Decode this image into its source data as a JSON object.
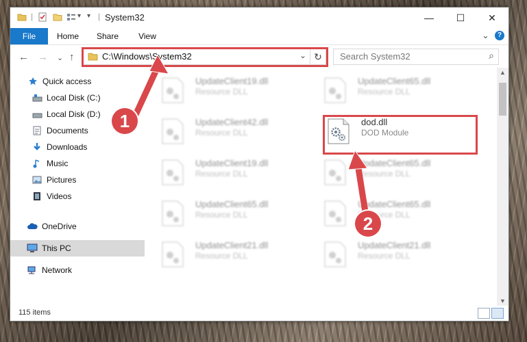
{
  "window": {
    "title": "System32",
    "minimize": "—",
    "maximize": "☐",
    "close": "✕"
  },
  "ribbon": {
    "tabs": [
      "File",
      "Home",
      "Share",
      "View"
    ],
    "expand_icon": "⌄",
    "help_icon": "?"
  },
  "navigation": {
    "back": "←",
    "forward": "→",
    "recent": "⌄",
    "up": "↑"
  },
  "address": {
    "path": "C:\\Windows\\System32",
    "dropdown": "⌄",
    "refresh": "↻"
  },
  "search": {
    "placeholder": "Search System32",
    "icon": "⌕"
  },
  "sidebar": {
    "items": [
      {
        "label": "Quick access",
        "icon": "star-icon"
      },
      {
        "label": "Local Disk (C:)",
        "icon": "drive-icon"
      },
      {
        "label": "Local Disk (D:)",
        "icon": "drive-icon"
      },
      {
        "label": "Documents",
        "icon": "documents-icon"
      },
      {
        "label": "Downloads",
        "icon": "download-icon"
      },
      {
        "label": "Music",
        "icon": "music-icon"
      },
      {
        "label": "Pictures",
        "icon": "pictures-icon"
      },
      {
        "label": "Videos",
        "icon": "videos-icon"
      },
      {
        "label": "OneDrive",
        "icon": "cloud-icon"
      },
      {
        "label": "This PC",
        "icon": "computer-icon"
      },
      {
        "label": "Network",
        "icon": "network-icon"
      }
    ]
  },
  "files": [
    {
      "name": "UpdateClient19.dll",
      "type": "Resource DLL"
    },
    {
      "name": "UpdateClient65.dll",
      "type": "Resource DLL"
    },
    {
      "name": "UpdateClient42.dll",
      "type": "Resource DLL"
    },
    {
      "name": "dod.dll",
      "type": "DOD Module"
    },
    {
      "name": "UpdateClient19.dll",
      "type": "Resource DLL"
    },
    {
      "name": "UpdateClient65.dll",
      "type": "Resource DLL"
    },
    {
      "name": "UpdateClient65.dll",
      "type": "Resource DLL"
    },
    {
      "name": "UpdateClient65.dll",
      "type": "Resource DLL"
    },
    {
      "name": "UpdateClient21.dll",
      "type": "Resource DLL"
    },
    {
      "name": "UpdateClient21.dll",
      "type": "Resource DLL"
    }
  ],
  "status": {
    "count": "115 items"
  },
  "annotations": {
    "marker1": "1",
    "marker2": "2",
    "color": "#d9474a"
  }
}
